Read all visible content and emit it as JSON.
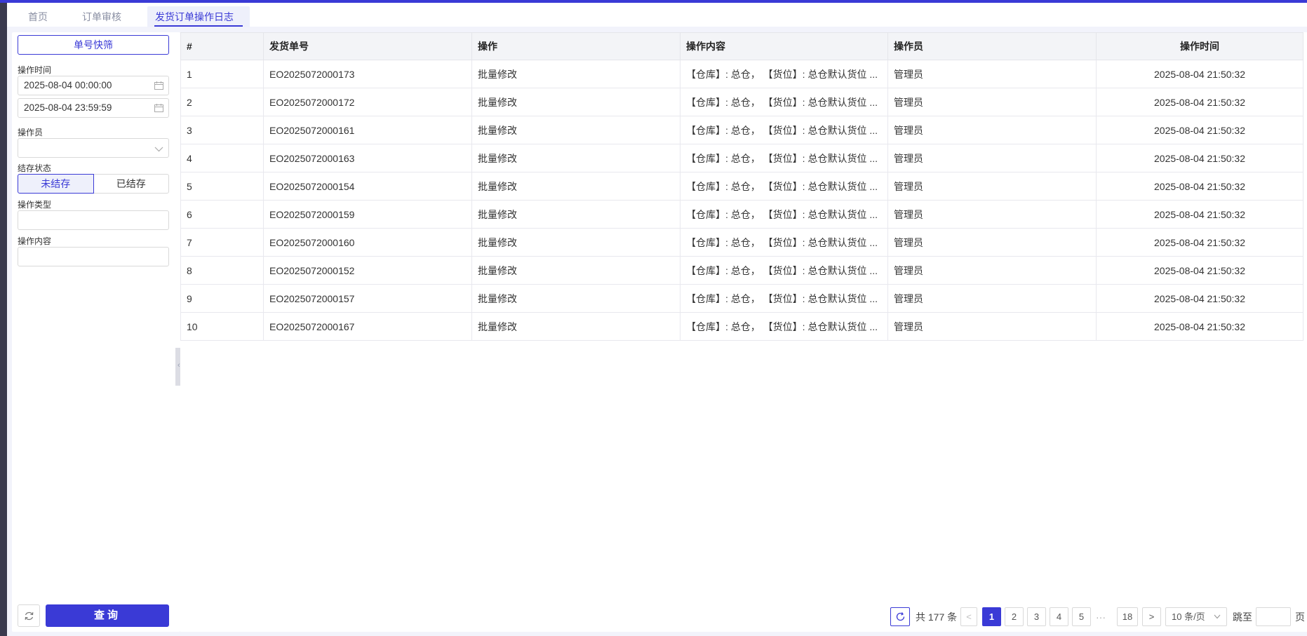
{
  "tabs": [
    {
      "label": "首页"
    },
    {
      "label": "订单审核"
    },
    {
      "label": "发货订单操作日志"
    }
  ],
  "sidebar": {
    "quick_filter": "单号快筛",
    "op_time_label": "操作时间",
    "start_time": "2025-08-04 00:00:00",
    "end_time": "2025-08-04 23:59:59",
    "operator_label": "操作员",
    "operator_value": "",
    "settle_label": "结存状态",
    "settle_options": [
      "未结存",
      "已结存"
    ],
    "op_type_label": "操作类型",
    "op_content_label": "操作内容",
    "query_label": "查询"
  },
  "table": {
    "headers": [
      "#",
      "发货单号",
      "操作",
      "操作内容",
      "操作员",
      "操作时间"
    ],
    "rows": [
      [
        "1",
        "EO2025072000173",
        "批量修改",
        "【仓库】: 总仓， 【货位】: 总仓默认货位 ...",
        "管理员",
        "2025-08-04 21:50:32"
      ],
      [
        "2",
        "EO2025072000172",
        "批量修改",
        "【仓库】: 总仓， 【货位】: 总仓默认货位 ...",
        "管理员",
        "2025-08-04 21:50:32"
      ],
      [
        "3",
        "EO2025072000161",
        "批量修改",
        "【仓库】: 总仓， 【货位】: 总仓默认货位 ...",
        "管理员",
        "2025-08-04 21:50:32"
      ],
      [
        "4",
        "EO2025072000163",
        "批量修改",
        "【仓库】: 总仓， 【货位】: 总仓默认货位 ...",
        "管理员",
        "2025-08-04 21:50:32"
      ],
      [
        "5",
        "EO2025072000154",
        "批量修改",
        "【仓库】: 总仓， 【货位】: 总仓默认货位 ...",
        "管理员",
        "2025-08-04 21:50:32"
      ],
      [
        "6",
        "EO2025072000159",
        "批量修改",
        "【仓库】: 总仓， 【货位】: 总仓默认货位 ...",
        "管理员",
        "2025-08-04 21:50:32"
      ],
      [
        "7",
        "EO2025072000160",
        "批量修改",
        "【仓库】: 总仓， 【货位】: 总仓默认货位 ...",
        "管理员",
        "2025-08-04 21:50:32"
      ],
      [
        "8",
        "EO2025072000152",
        "批量修改",
        "【仓库】: 总仓， 【货位】: 总仓默认货位 ...",
        "管理员",
        "2025-08-04 21:50:32"
      ],
      [
        "9",
        "EO2025072000157",
        "批量修改",
        "【仓库】: 总仓， 【货位】: 总仓默认货位 ...",
        "管理员",
        "2025-08-04 21:50:32"
      ],
      [
        "10",
        "EO2025072000167",
        "批量修改",
        "【仓库】: 总仓， 【货位】: 总仓默认货位 ...",
        "管理员",
        "2025-08-04 21:50:32"
      ]
    ]
  },
  "pagination": {
    "total_text": "共 177 条",
    "prev": "<",
    "pages": [
      "1",
      "2",
      "3",
      "4",
      "5"
    ],
    "ellipsis": "···",
    "last_page": "18",
    "next": ">",
    "page_size": "10 条/页",
    "jump_label": "跳至",
    "jump_value": "",
    "page_suffix": "页",
    "current_page": 1
  },
  "colors": {
    "accent": "#3a3ad6",
    "frame": "#3a3a4e",
    "app_bg": "#f2f3fb"
  }
}
